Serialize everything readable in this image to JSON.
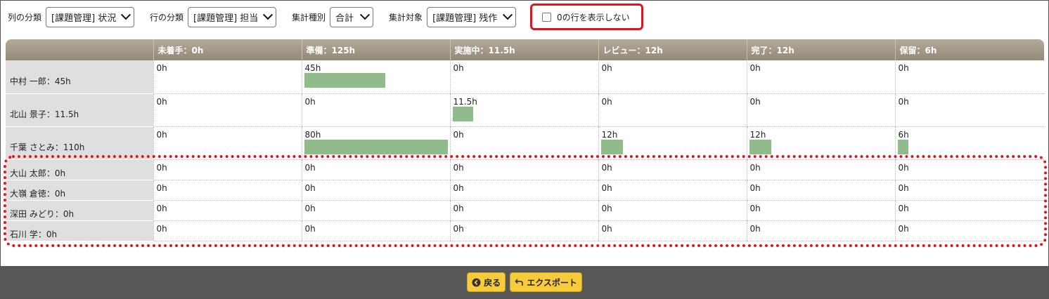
{
  "toolbar": {
    "col_label": "列の分類",
    "col_value": "[課題管理] 状況",
    "row_label": "行の分類",
    "row_value": "[課題管理] 担当",
    "agg_label": "集計種別",
    "agg_value": "合計",
    "target_label": "集計対象",
    "target_value": "[課題管理] 残作",
    "hide_zero_label": "0の行を表示しない"
  },
  "table": {
    "columns": [
      "未着手：0h",
      "準備：125h",
      "実施中：11.5h",
      "レビュー：12h",
      "完了：12h",
      "保留：6h"
    ],
    "rows": [
      {
        "name": "中村 一郎：45h",
        "cells": [
          "0h",
          "45h",
          "0h",
          "0h",
          "0h",
          "0h"
        ]
      },
      {
        "name": "北山 景子：11.5h",
        "cells": [
          "0h",
          "0h",
          "11.5h",
          "0h",
          "0h",
          "0h"
        ]
      },
      {
        "name": "千葉 さとみ：110h",
        "cells": [
          "0h",
          "80h",
          "0h",
          "12h",
          "12h",
          "6h"
        ]
      },
      {
        "name": "大山 太郎：0h",
        "cells": [
          "0h",
          "0h",
          "0h",
          "0h",
          "0h",
          "0h"
        ]
      },
      {
        "name": "大嶺 倉徳：0h",
        "cells": [
          "0h",
          "0h",
          "0h",
          "0h",
          "0h",
          "0h"
        ]
      },
      {
        "name": "深田 みどり：0h",
        "cells": [
          "0h",
          "0h",
          "0h",
          "0h",
          "0h",
          "0h"
        ]
      },
      {
        "name": "石川 学：0h",
        "cells": [
          "0h",
          "0h",
          "0h",
          "0h",
          "0h",
          "0h"
        ]
      }
    ],
    "bars": [
      {
        "row": 0,
        "col": 1,
        "value": 45
      },
      {
        "row": 1,
        "col": 2,
        "value": 11.5
      },
      {
        "row": 2,
        "col": 1,
        "value": 80
      },
      {
        "row": 2,
        "col": 3,
        "value": 12
      },
      {
        "row": 2,
        "col": 4,
        "value": 12
      },
      {
        "row": 2,
        "col": 5,
        "value": 6
      }
    ],
    "bar_max": 80,
    "bar_color": "#8fbc8a"
  },
  "footer": {
    "back_label": "戻る",
    "export_label": "エクスポート"
  },
  "colors": {
    "header": "#a39a89",
    "highlight": "#e0141e",
    "button": "#f7cb3a",
    "footer": "#575757"
  }
}
